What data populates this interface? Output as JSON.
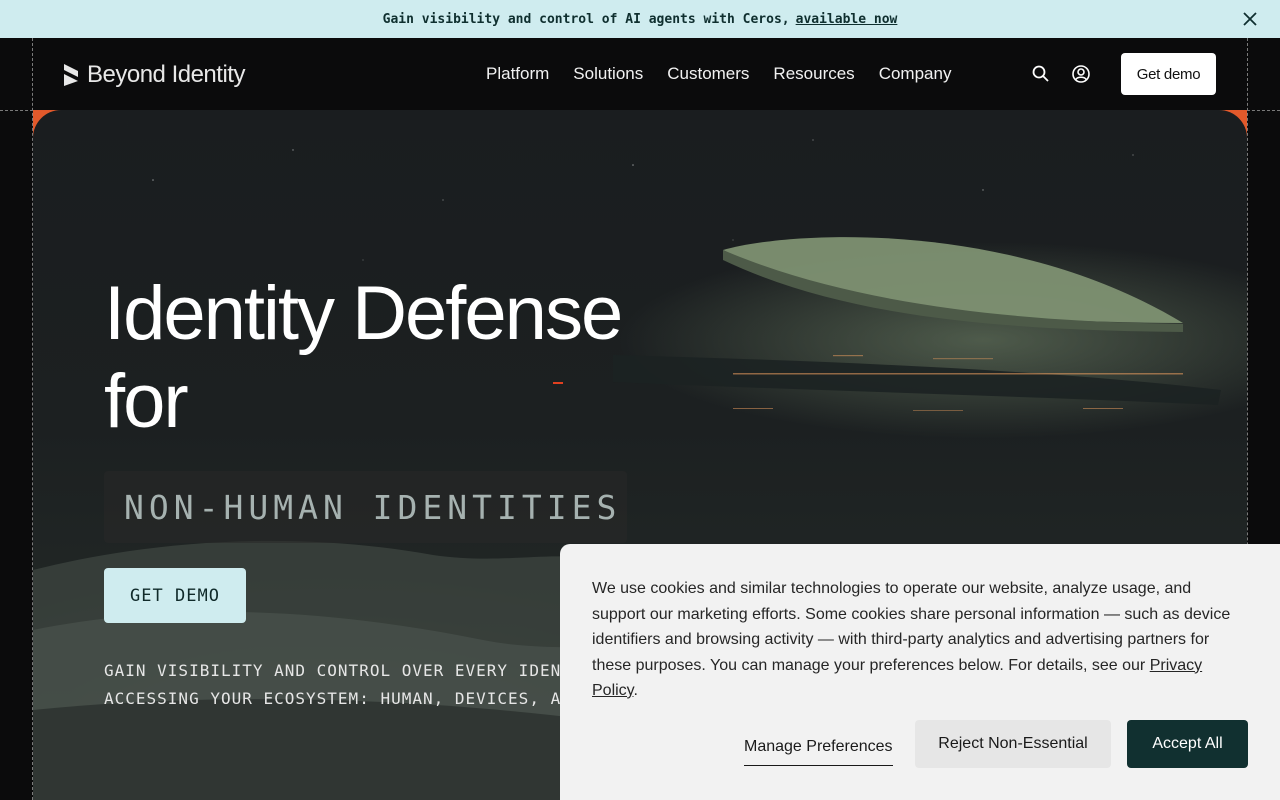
{
  "announcement": {
    "text": "Gain visibility and control of AI agents with Ceros,",
    "link": "available now"
  },
  "header": {
    "logo_text": "Beyond Identity",
    "nav": [
      "Platform",
      "Solutions",
      "Customers",
      "Resources",
      "Company"
    ],
    "cta": "Get demo"
  },
  "hero": {
    "headline_line1": "Identity Defense",
    "headline_line2": "for",
    "tag": "NON-HUMAN IDENTITIES",
    "cta": "GET DEMO",
    "sub_line1": "GAIN VISIBILITY AND CONTROL OVER EVERY IDEN",
    "sub_line2": "ACCESSING YOUR ECOSYSTEM: HUMAN, DEVICES, A"
  },
  "cookie": {
    "text": "We use cookies and similar technologies to operate our website, analyze usage, and support our marketing efforts. Some cookies share personal information — such as device identifiers and browsing activity — with third-party analytics and advertising partners for these purposes. You can manage your preferences below. For details, see our",
    "link": "Privacy Policy",
    "after_link": ".",
    "manage": "Manage Preferences",
    "reject": "Reject Non-Essential",
    "accept": "Accept All"
  },
  "colors": {
    "announce_bg": "#cfecef",
    "accent_orange": "#e2592b",
    "accept_bg": "#113030"
  },
  "icons": [
    "close-icon",
    "logo-mark-icon",
    "search-icon",
    "user-account-icon"
  ]
}
